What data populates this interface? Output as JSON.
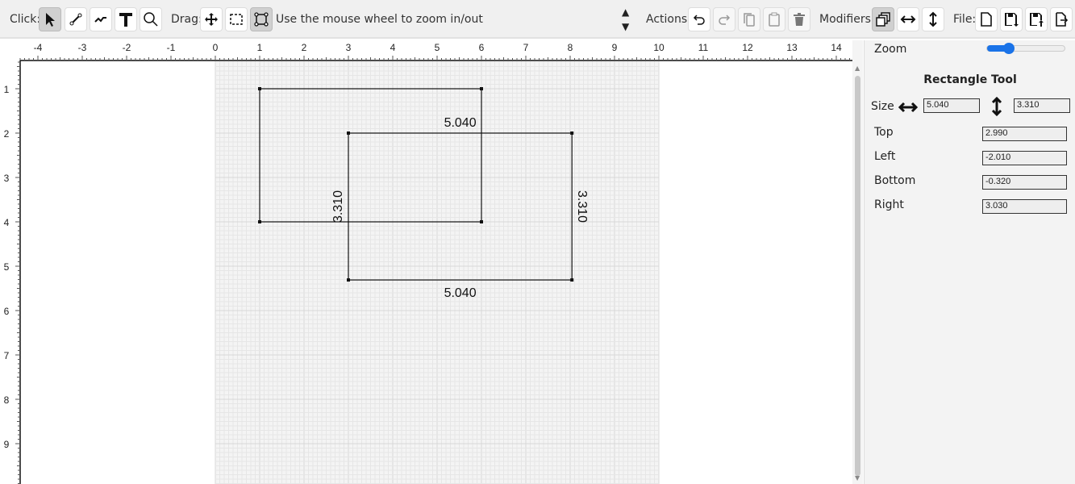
{
  "toolbar": {
    "click_label": "Click:",
    "click_tools": [
      {
        "name": "select-tool",
        "icon": "arrow-pointer-icon",
        "active": true
      },
      {
        "name": "line-tool",
        "icon": "line-icon"
      },
      {
        "name": "polyline-tool",
        "icon": "polyline-icon"
      },
      {
        "name": "text-tool",
        "icon": "text-icon"
      },
      {
        "name": "zoom-tool",
        "icon": "magnifier-icon"
      }
    ],
    "drag_label": "Drag:",
    "drag_tools": [
      {
        "name": "pan-tool",
        "icon": "move-icon"
      },
      {
        "name": "marquee-tool",
        "icon": "dashed-rect-icon"
      },
      {
        "name": "rectangle-tool",
        "icon": "rectangle-nodes-icon",
        "active": true
      }
    ],
    "hint": "Use the mouse wheel to zoom in/out",
    "actions_label": "Actions:",
    "actions": [
      {
        "name": "undo",
        "icon": "undo-icon"
      },
      {
        "name": "redo",
        "icon": "redo-icon",
        "disabled": true
      },
      {
        "name": "copy",
        "icon": "copy-icon",
        "disabled": true
      },
      {
        "name": "paste",
        "icon": "paste-icon",
        "disabled": true
      },
      {
        "name": "delete",
        "icon": "trash-icon",
        "disabled": true
      }
    ],
    "modifiers_label": "Modifiers:",
    "modifiers": [
      {
        "name": "overlap",
        "icon": "layers-icon",
        "active": true
      },
      {
        "name": "horizontal",
        "icon": "arrows-horizontal-icon"
      },
      {
        "name": "vertical",
        "icon": "arrows-vertical-icon"
      }
    ],
    "file_label": "File:",
    "file": [
      {
        "name": "new",
        "icon": "new-file-icon"
      },
      {
        "name": "save",
        "icon": "save-download-icon"
      },
      {
        "name": "load",
        "icon": "save-upload-icon"
      },
      {
        "name": "export",
        "icon": "export-icon"
      }
    ]
  },
  "ruler": {
    "x_labels": [
      "-4",
      "-3",
      "-2",
      "-1",
      "0",
      "1",
      "2",
      "3",
      "4",
      "5",
      "6",
      "7",
      "8",
      "9",
      "10",
      "11",
      "12",
      "13",
      "14"
    ],
    "y_labels": [
      "1",
      "2",
      "3",
      "4",
      "5",
      "6",
      "7",
      "8",
      "9"
    ]
  },
  "shapes": [
    {
      "x": 1,
      "y": 1,
      "w": 5,
      "h": 3
    },
    {
      "x": 3,
      "y": 2,
      "w": 5.04,
      "h": 3.31,
      "width_label": "5.040",
      "height_label": "3.310"
    }
  ],
  "panel": {
    "zoom_label": "Zoom",
    "zoom_value": 0.2,
    "title": "Rectangle Tool",
    "size_label": "Size",
    "width": "5.040",
    "height": "3.310",
    "fields": [
      {
        "label": "Top",
        "value": "2.990"
      },
      {
        "label": "Left",
        "value": "-2.010"
      },
      {
        "label": "Bottom",
        "value": "-0.320"
      },
      {
        "label": "Right",
        "value": "3.030"
      }
    ]
  }
}
